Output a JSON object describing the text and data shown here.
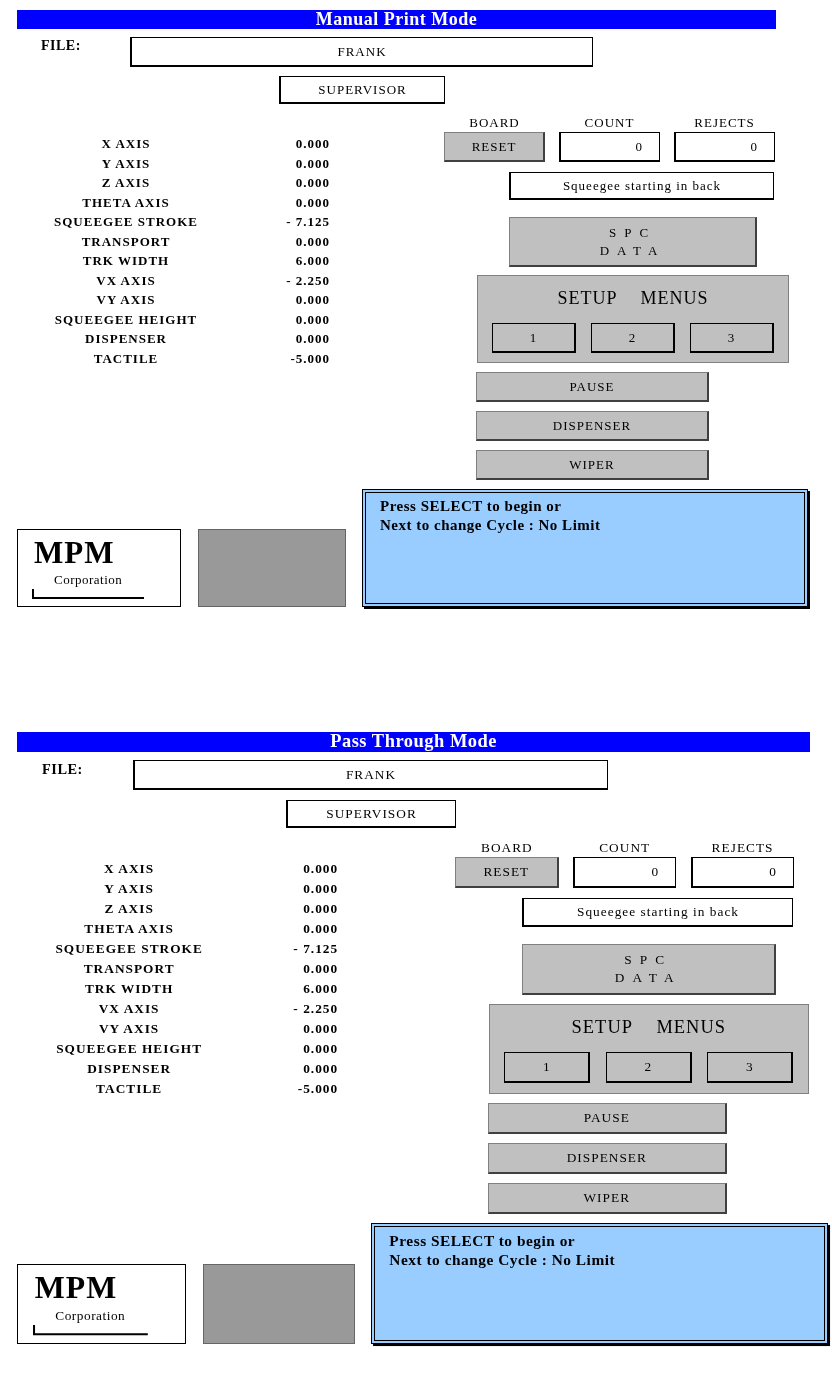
{
  "panels": [
    {
      "title": "Manual Print Mode",
      "file_label": "FILE:",
      "file": "FRANK",
      "user": "SUPERVISOR",
      "axes": [
        {
          "label": "X AXIS",
          "value": "0.000"
        },
        {
          "label": "Y AXIS",
          "value": "0.000"
        },
        {
          "label": "Z AXIS",
          "value": "0.000"
        },
        {
          "label": "THETA AXIS",
          "value": "0.000"
        },
        {
          "label": "SQUEEGEE STROKE",
          "value": "- 7.125"
        },
        {
          "label": "TRANSPORT",
          "value": "0.000"
        },
        {
          "label": "TRK WIDTH",
          "value": "6.000"
        },
        {
          "label": "VX AXIS",
          "value": "- 2.250"
        },
        {
          "label": "VY AXIS",
          "value": "0.000"
        },
        {
          "label": "SQUEEGEE HEIGHT",
          "value": "0.000"
        },
        {
          "label": "DISPENSER",
          "value": "0.000"
        },
        {
          "label": "TACTILE",
          "value": "-5.000"
        }
      ],
      "counters": {
        "board_label": "BOARD",
        "reset": "RESET",
        "count_label": "COUNT",
        "count": "0",
        "rejects_label": "REJECTS",
        "rejects": "0"
      },
      "status": "Squeegee starting in back",
      "spc": [
        "SPC",
        "DATA"
      ],
      "setup_title": "SETUP MENUS",
      "menu_buttons": [
        "1",
        "2",
        "3"
      ],
      "actions": [
        "PAUSE",
        "DISPENSER",
        "WIPER"
      ],
      "logo": {
        "name": "MPM",
        "subtitle": "Corporation"
      },
      "message": [
        "Press SELECT to begin or",
        "Next to change Cycle : No Limit"
      ]
    },
    {
      "title": "Pass Through Mode",
      "file_label": "FILE:",
      "file": "FRANK",
      "user": "SUPERVISOR",
      "axes": [
        {
          "label": "X AXIS",
          "value": "0.000"
        },
        {
          "label": "Y AXIS",
          "value": "0.000"
        },
        {
          "label": "Z AXIS",
          "value": "0.000"
        },
        {
          "label": "THETA AXIS",
          "value": "0.000"
        },
        {
          "label": "SQUEEGEE STROKE",
          "value": "- 7.125"
        },
        {
          "label": "TRANSPORT",
          "value": "0.000"
        },
        {
          "label": "TRK WIDTH",
          "value": "6.000"
        },
        {
          "label": "VX AXIS",
          "value": "- 2.250"
        },
        {
          "label": "VY AXIS",
          "value": "0.000"
        },
        {
          "label": "SQUEEGEE HEIGHT",
          "value": "0.000"
        },
        {
          "label": "DISPENSER",
          "value": "0.000"
        },
        {
          "label": "TACTILE",
          "value": "-5.000"
        }
      ],
      "counters": {
        "board_label": "BOARD",
        "reset": "RESET",
        "count_label": "COUNT",
        "count": "0",
        "rejects_label": "REJECTS",
        "rejects": "0"
      },
      "status": "Squeegee starting in back",
      "spc": [
        "SPC",
        "DATA"
      ],
      "setup_title": "SETUP MENUS",
      "menu_buttons": [
        "1",
        "2",
        "3"
      ],
      "actions": [
        "PAUSE",
        "DISPENSER",
        "WIPER"
      ],
      "logo": {
        "name": "MPM",
        "subtitle": "Corporation"
      },
      "message": [
        "Press SELECT to begin or",
        "Next to change Cycle : No Limit"
      ]
    }
  ]
}
